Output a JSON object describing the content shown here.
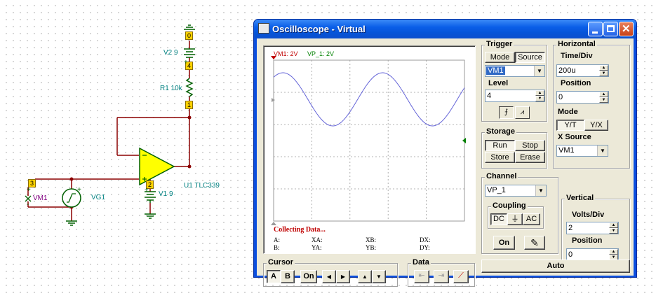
{
  "schematic": {
    "v2_label": "V2 9",
    "r1_label": "R1 10k",
    "u1_label": "U1 TLC339",
    "v1_label": "V1 9",
    "vg1_label": "VG1",
    "vm1_label": "VM1",
    "nodes": [
      "0",
      "4",
      "1",
      "2",
      "3"
    ],
    "plus": "+",
    "minus": "-"
  },
  "window": {
    "title": "Oscilloscope - Virtual"
  },
  "screen": {
    "legend_vm1": "VM1: 2V",
    "legend_vp1": "VP_1: 2V",
    "status": "Collecting Data...",
    "readouts": {
      "a": "A:",
      "b": "B:",
      "xa": "XA:",
      "ya": "YA:",
      "xb": "XB:",
      "yb": "YB:",
      "dx": "DX:",
      "dy": "DY:"
    },
    "colors": {
      "vm1": "#c00000",
      "vp1": "#008000",
      "trace": "#6464d8",
      "grid": "#9a9a9a"
    }
  },
  "trigger": {
    "title": "Trigger",
    "mode_label": "Mode",
    "source_label": "Source",
    "source_value": "VM1",
    "level_label": "Level",
    "level_value": "4"
  },
  "storage": {
    "title": "Storage",
    "run": "Run",
    "stop": "Stop",
    "store": "Store",
    "erase": "Erase"
  },
  "channel": {
    "title": "Channel",
    "value": "VP_1",
    "coupling_title": "Coupling",
    "dc": "DC",
    "ac": "AC",
    "on": "On"
  },
  "horizontal": {
    "title": "Horizontal",
    "timediv_label": "Time/Div",
    "timediv_value": "200u",
    "position_label": "Position",
    "position_value": "0",
    "mode_label": "Mode",
    "yt": "Y/T",
    "yx": "Y/X",
    "xsource_label": "X Source",
    "xsource_value": "VM1"
  },
  "vertical": {
    "title": "Vertical",
    "voltsdiv_label": "Volts/Div",
    "voltsdiv_value": "2",
    "position_label": "Position",
    "position_value": "0"
  },
  "cursor": {
    "title": "Cursor",
    "a": "A",
    "b": "B",
    "on": "On"
  },
  "data_group": {
    "title": "Data"
  },
  "auto_label": "Auto"
}
